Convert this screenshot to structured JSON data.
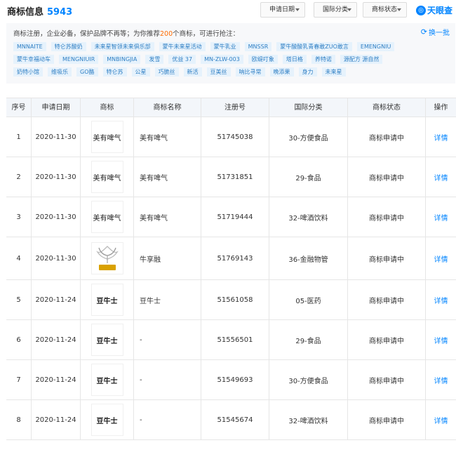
{
  "header": {
    "title": "商标信息",
    "count": "5943",
    "filters": [
      "申请日期",
      "国际分类",
      "商标状态"
    ],
    "brand": "天眼查"
  },
  "recommend": {
    "prefix": "商标注册，企业必备，保护品牌不再等；为你推荐",
    "number": "200",
    "suffix": "个商标，可进行抢注：",
    "swap_label": "换一批",
    "rows": [
      [
        "MNNAITE",
        "特仑苏酸奶",
        "未来星智领未来俱乐部",
        "蒙牛未来星活动",
        "蒙牛乳业",
        "MNSSR",
        "蒙牛酸酸乳青春敢ZUO敢言",
        "EMENGNIU"
      ],
      [
        "蒙牛幸福动车",
        "MENGNIUIR",
        "MNBINGJIA",
        "发雪",
        "优益 37",
        "MN-ZLW-003",
        "欧缇叮象",
        "塔日格",
        "养特诺",
        "源配方 源自然"
      ],
      [
        "奶特小馆",
        "维吸乐",
        "GO酪",
        "特仑苏",
        "公星",
        "巧脆丝",
        "新活",
        "豆美丝",
        "呐比寻常",
        "晚添果",
        "身力",
        "未来星"
      ]
    ]
  },
  "table": {
    "headers": [
      "序号",
      "申请日期",
      "商标",
      "商标名称",
      "注册号",
      "国际分类",
      "商标状态",
      "操作"
    ],
    "rows": [
      {
        "index": "1",
        "date": "2020-11-30",
        "logo_text": "美有啤气",
        "name": "美有啤气",
        "reg_no": "51745038",
        "class": "30-方便食品",
        "status": "商标申请中",
        "action": "详情"
      },
      {
        "index": "2",
        "date": "2020-11-30",
        "logo_text": "美有啤气",
        "name": "美有啤气",
        "reg_no": "51731851",
        "class": "29-食品",
        "status": "商标申请中",
        "action": "详情"
      },
      {
        "index": "3",
        "date": "2020-11-30",
        "logo_text": "美有啤气",
        "name": "美有啤气",
        "reg_no": "51719444",
        "class": "32-啤酒饮料",
        "status": "商标申请中",
        "action": "详情"
      },
      {
        "index": "4",
        "date": "2020-11-30",
        "logo_text": "牛享融",
        "name": "牛享融",
        "reg_no": "51769143",
        "class": "36-金融物管",
        "status": "商标申请中",
        "action": "详情"
      },
      {
        "index": "5",
        "date": "2020-11-24",
        "logo_text": "豆牛士",
        "name": "豆牛士",
        "reg_no": "51561058",
        "class": "05-医药",
        "status": "商标申请中",
        "action": "详情"
      },
      {
        "index": "6",
        "date": "2020-11-24",
        "logo_text": "豆牛士",
        "name": "-",
        "reg_no": "51556501",
        "class": "29-食品",
        "status": "商标申请中",
        "action": "详情"
      },
      {
        "index": "7",
        "date": "2020-11-24",
        "logo_text": "豆牛士",
        "name": "-",
        "reg_no": "51549693",
        "class": "30-方便食品",
        "status": "商标申请中",
        "action": "详情"
      },
      {
        "index": "8",
        "date": "2020-11-24",
        "logo_text": "豆牛士",
        "name": "-",
        "reg_no": "51545674",
        "class": "32-啤酒饮料",
        "status": "商标申请中",
        "action": "详情"
      }
    ]
  }
}
